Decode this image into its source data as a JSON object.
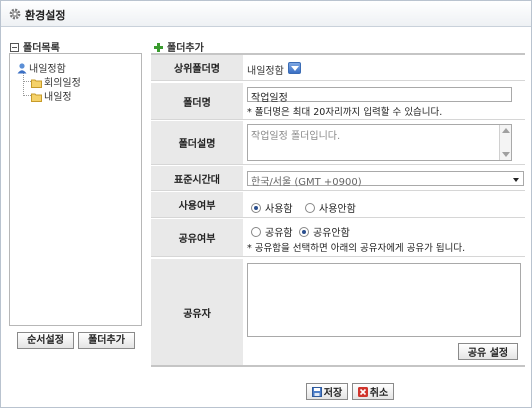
{
  "window": {
    "title": "환경설정"
  },
  "left": {
    "title": "폴더목록",
    "tree": {
      "root": "내일정함",
      "children": [
        "회의일정",
        "내일정"
      ]
    },
    "buttons": {
      "order": "순서설정",
      "add": "폴더추가"
    }
  },
  "form": {
    "section_title": "폴더추가",
    "parent": {
      "label": "상위폴더명",
      "value": "내일정함"
    },
    "name": {
      "label": "폴더명",
      "value": "작업일정",
      "note": "* 폴더명은 최대 20자리까지 입력할 수 있습니다."
    },
    "desc": {
      "label": "폴더설명",
      "value": "작업일정 폴더입니다."
    },
    "timezone": {
      "label": "표준시간대",
      "value": "한국/서울 (GMT +0900)"
    },
    "use": {
      "label": "사용여부",
      "options": [
        "사용함",
        "사용안함"
      ],
      "selected": 0
    },
    "share": {
      "label": "공유여부",
      "options": [
        "공유함",
        "공유안함"
      ],
      "selected": 1,
      "note": "* 공유함을 선택하면 아래의 공유자에게 공유가 됩니다."
    },
    "sharer": {
      "label": "공유자",
      "button": "공유 설정"
    }
  },
  "footer": {
    "save": "저장",
    "cancel": "취소"
  },
  "colors": {
    "accent": "#3a6fc4",
    "label_bg": "#e9e9e9",
    "plus": "#3a9b2f",
    "cancel_x": "#d0342c"
  }
}
